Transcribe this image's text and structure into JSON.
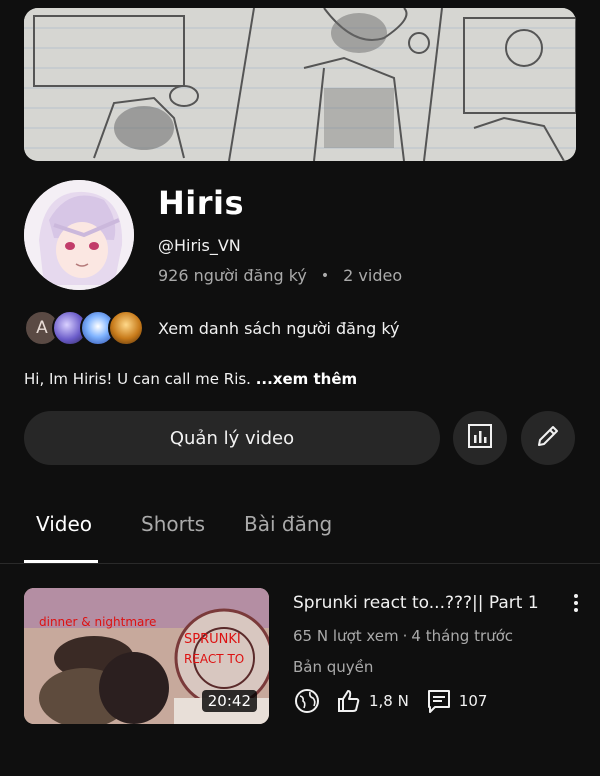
{
  "channel": {
    "name": "Hiris",
    "handle": "@Hiris_VN",
    "subscribers": "926 người đăng ký",
    "video_count": "2 video",
    "subscriber_list_link": "Xem danh sách người đăng ký",
    "subscriber_initial": "A",
    "bio": "Hi, Im Hiris! U can call me Ris. ",
    "bio_more": "...xem thêm"
  },
  "actions": {
    "manage_videos": "Quản lý video"
  },
  "tabs": [
    {
      "label": "Video",
      "active": true
    },
    {
      "label": "Shorts",
      "active": false
    },
    {
      "label": "Bài đăng",
      "active": false
    }
  ],
  "videos": [
    {
      "title": "Sprunki react to...???|| Part 1",
      "views": "65 N lượt xem",
      "age": "4 tháng trước",
      "rights": "Bản quyền",
      "duration": "20:42",
      "likes": "1,8 N",
      "comments": "107",
      "visibility_icon": "globe-icon"
    }
  ],
  "colors": {
    "background": "#0f0f0f",
    "button": "#272727",
    "secondary_text": "#aaaaaa"
  }
}
